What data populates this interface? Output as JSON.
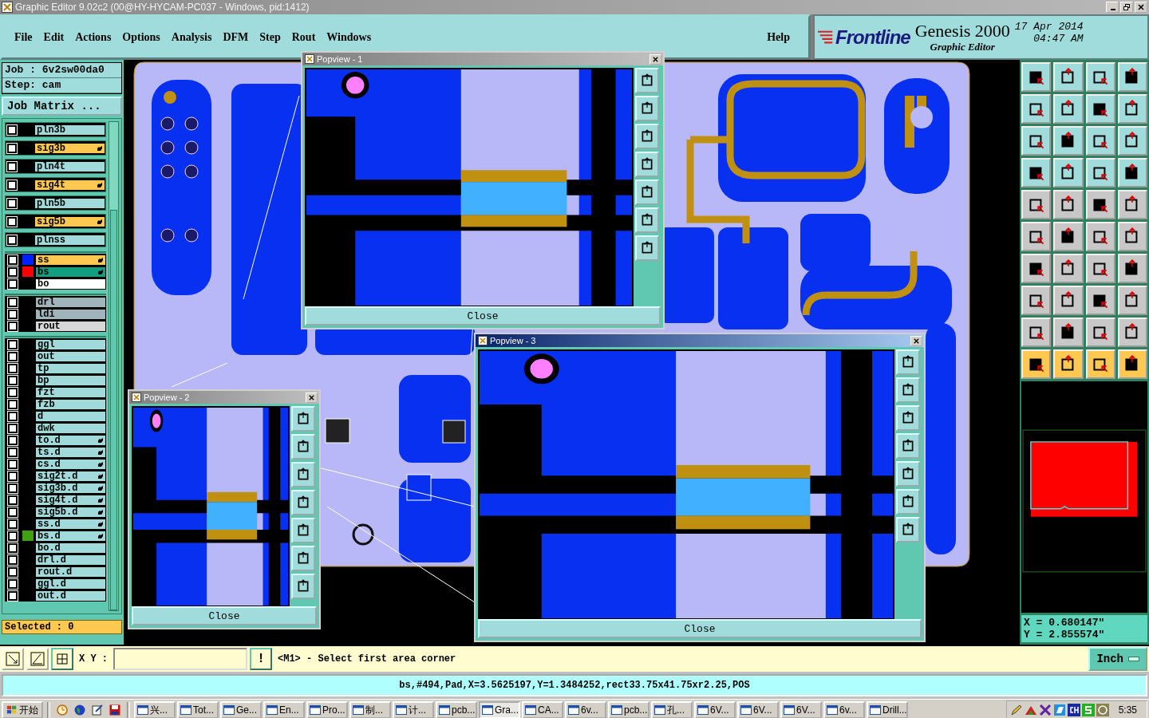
{
  "window": {
    "title": "Graphic Editor 9.02c2 (00@HY-HYCAM-PC037 - Windows, pid:1412)"
  },
  "menu": [
    {
      "label": "File"
    },
    {
      "label": "Edit"
    },
    {
      "label": "Actions"
    },
    {
      "label": "Options"
    },
    {
      "label": "Analysis"
    },
    {
      "label": "DFM"
    },
    {
      "label": "Step"
    },
    {
      "label": "Rout"
    },
    {
      "label": "Windows"
    }
  ],
  "help": "Help",
  "brand": {
    "logo": "Frontline",
    "product": "Genesis 2000",
    "subtitle": "Graphic Editor",
    "date": "17 Apr 2014",
    "time": "04:47 AM"
  },
  "job": {
    "job": "Job : 6v2sw00da0",
    "step": "Step: cam",
    "matrix_button": "Job Matrix ..."
  },
  "layer_groups": [
    {
      "kind": "boxed",
      "layers": [
        {
          "name": "pln3b",
          "kind": "plane",
          "checked": false,
          "affected": false
        },
        {
          "name": "sig3b",
          "kind": "signal",
          "checked": false,
          "affected": true
        },
        {
          "name": "pln4t",
          "kind": "plane",
          "checked": false,
          "affected": false
        },
        {
          "name": "sig4t",
          "kind": "signal",
          "checked": false,
          "affected": true
        },
        {
          "name": "pln5b",
          "kind": "plane",
          "checked": false,
          "affected": false
        },
        {
          "name": "sig5b",
          "kind": "signal",
          "checked": false,
          "affected": true
        },
        {
          "name": "plnss",
          "kind": "plane",
          "checked": false,
          "affected": false
        }
      ]
    },
    {
      "kind": "list",
      "layers": [
        {
          "name": "ss",
          "kind": "signal",
          "checked": false,
          "affected": true,
          "color": "#0020ff"
        },
        {
          "name": "bs",
          "kind": "work",
          "checked": false,
          "affected": true,
          "color": "#ff0000"
        },
        {
          "name": "bo",
          "kind": "outline",
          "checked": false,
          "affected": false
        }
      ]
    },
    {
      "kind": "list",
      "layers": [
        {
          "name": "drl",
          "kind": "drill",
          "checked": false,
          "affected": false
        },
        {
          "name": "ldi",
          "kind": "drill",
          "checked": false,
          "affected": false
        },
        {
          "name": "rout",
          "kind": "rout",
          "checked": false,
          "affected": false
        }
      ]
    },
    {
      "kind": "list",
      "layers": [
        {
          "name": "ggl",
          "kind": "document",
          "checked": false,
          "affected": false
        },
        {
          "name": "out",
          "kind": "document",
          "checked": false,
          "affected": false
        },
        {
          "name": "tp",
          "kind": "document",
          "checked": false,
          "affected": false
        },
        {
          "name": "bp",
          "kind": "document",
          "checked": false,
          "affected": false
        },
        {
          "name": "fzt",
          "kind": "document",
          "checked": false,
          "affected": false
        },
        {
          "name": "fzb",
          "kind": "document",
          "checked": false,
          "affected": false
        },
        {
          "name": "d",
          "kind": "document",
          "checked": false,
          "affected": false
        },
        {
          "name": "dwk",
          "kind": "document",
          "checked": false,
          "affected": false
        },
        {
          "name": "to.d",
          "kind": "document",
          "checked": false,
          "affected": true
        },
        {
          "name": "ts.d",
          "kind": "document",
          "checked": false,
          "affected": true
        },
        {
          "name": "cs.d",
          "kind": "document",
          "checked": false,
          "affected": true
        },
        {
          "name": "sig2t.d",
          "kind": "document",
          "checked": false,
          "affected": true
        },
        {
          "name": "sig3b.d",
          "kind": "document",
          "checked": false,
          "affected": true
        },
        {
          "name": "sig4t.d",
          "kind": "document",
          "checked": false,
          "affected": true
        },
        {
          "name": "sig5b.d",
          "kind": "document",
          "checked": false,
          "affected": true
        },
        {
          "name": "ss.d",
          "kind": "document",
          "checked": false,
          "affected": true
        },
        {
          "name": "bs.d",
          "kind": "document",
          "checked": false,
          "affected": true,
          "color": "#40a010"
        },
        {
          "name": "bo.d",
          "kind": "document",
          "checked": false,
          "affected": false
        },
        {
          "name": "drl.d",
          "kind": "document",
          "checked": false,
          "affected": false
        },
        {
          "name": "rout.d",
          "kind": "document",
          "checked": false,
          "affected": false
        },
        {
          "name": "ggl.d",
          "kind": "document",
          "checked": false,
          "affected": false
        },
        {
          "name": "out.d",
          "kind": "document",
          "checked": false,
          "affected": false
        }
      ]
    }
  ],
  "selected_count": "Selected : 0",
  "popviews": [
    {
      "title": "Popview - 1",
      "close": "Close"
    },
    {
      "title": "Popview - 2",
      "close": "Close"
    },
    {
      "title": "Popview - 3",
      "close": "Close"
    }
  ],
  "coordinates": {
    "x": "X = 0.680147\"",
    "y": "Y = 2.855574\""
  },
  "command": {
    "xy_label": "X Y :",
    "alert": "!",
    "message": "<M1> - Select first area corner",
    "units": "Inch"
  },
  "status": "bs,#494,Pad,X=3.5625197,Y=1.3484252,rect33.75x41.75xr2.25,POS",
  "taskbar": {
    "start": "开始",
    "tasks": [
      {
        "label": "兴...",
        "selected": false
      },
      {
        "label": "Tot...",
        "selected": false
      },
      {
        "label": "Ge...",
        "selected": false
      },
      {
        "label": "En...",
        "selected": false
      },
      {
        "label": "Pro...",
        "selected": false
      },
      {
        "label": "制...",
        "selected": false
      },
      {
        "label": "计...",
        "selected": false
      },
      {
        "label": "pcb...",
        "selected": false
      },
      {
        "label": "Gra...",
        "selected": true
      },
      {
        "label": "CA...",
        "selected": false
      },
      {
        "label": "6v...",
        "selected": false
      },
      {
        "label": "pcb...",
        "selected": false
      },
      {
        "label": "孔...",
        "selected": false
      },
      {
        "label": "6V...",
        "selected": false
      },
      {
        "label": "6V...",
        "selected": false
      },
      {
        "label": "6V...",
        "selected": false
      },
      {
        "label": "6v...",
        "selected": false
      },
      {
        "label": "Drill...",
        "selected": false
      }
    ],
    "clock": "5:35"
  }
}
